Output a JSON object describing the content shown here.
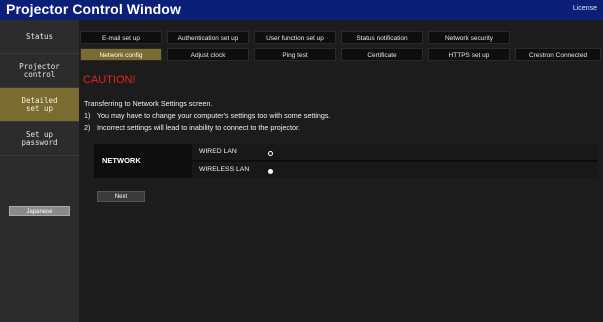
{
  "header": {
    "title": "Projector Control Window",
    "license": "License"
  },
  "sidebar": {
    "items": [
      {
        "label": "Status"
      },
      {
        "label": "Projector\ncontrol"
      },
      {
        "label": "Detailed\nset up"
      },
      {
        "label": "Set up\npassword"
      }
    ],
    "active_index": 2,
    "language_button": "Japanese"
  },
  "tabs": {
    "row1": [
      "E-mail set up",
      "Authentication set up",
      "User function set up",
      "Status notification",
      "Network security"
    ],
    "row2": [
      "Network config",
      "Adjust clock",
      "Ping test",
      "Certificate",
      "HTTPS set up",
      "Crestron Connected"
    ],
    "active": "Network config"
  },
  "content": {
    "caution": "CAUTION!",
    "intro": "Transferring to Network Settings screen.",
    "notes": [
      {
        "num": "1)",
        "text": "You may have to change your computer's settings too with some settings."
      },
      {
        "num": "2)",
        "text": "Incorrect settings will lead to inability to connect to the projector."
      }
    ]
  },
  "network": {
    "label": "NETWORK",
    "options": [
      {
        "label": "WIRED LAN",
        "selected": false
      },
      {
        "label": "WIRELESS LAN",
        "selected": true
      }
    ]
  },
  "buttons": {
    "next": "Next"
  },
  "colors": {
    "title_bar": "#0b1f78",
    "active_tab": "#7a6b31",
    "caution_text": "#e52222",
    "background": "#1c1c1c"
  }
}
